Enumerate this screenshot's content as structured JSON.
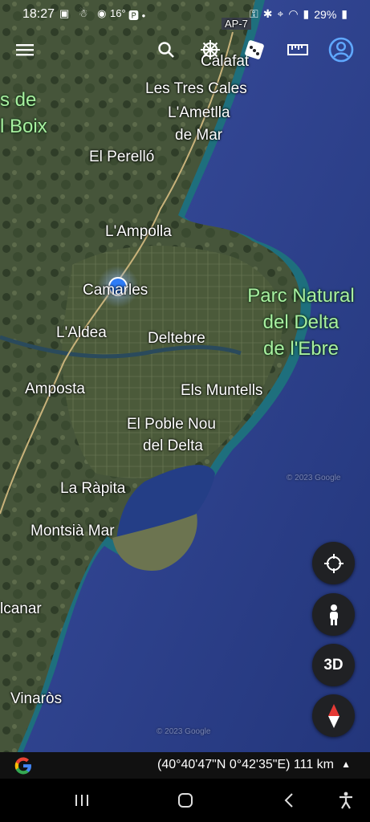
{
  "status_bar": {
    "time": "18:27",
    "temperature": "16°",
    "battery": "29%"
  },
  "toolbar": {
    "menu": "menu-icon",
    "search": "search-icon",
    "voyager": "ship-wheel-icon",
    "random": "dice-icon",
    "measure": "ruler-icon",
    "account": "account-icon"
  },
  "map": {
    "road_shield": "AP-7",
    "places": [
      "Calafat",
      "Les Tres Cales",
      "L'Ametlla",
      "de Mar",
      "El Perelló",
      "L'Ampolla",
      "Camarles",
      "L'Aldea",
      "Deltebre",
      "Amposta",
      "Els Muntells",
      "El Poble Nou",
      "del Delta",
      "La Ràpita",
      "Montsià Mar",
      "lcanar",
      "Vinaròs"
    ],
    "park_label": [
      "Parc Natural",
      "del Delta",
      "de l'Ebre"
    ],
    "partial_label": [
      "s de",
      "l Boix"
    ],
    "watermark": "© 2023 Google"
  },
  "fabs": {
    "threed": "3D"
  },
  "bottom_bar": {
    "coordinates": "(40°40'47\"N 0°42'35\"E) 111 km"
  },
  "colors": {
    "sea": "#2a3f86",
    "shelf": "#1f6f80",
    "park_text": "#a8f0a0",
    "location_dot": "#2f7cf6"
  }
}
